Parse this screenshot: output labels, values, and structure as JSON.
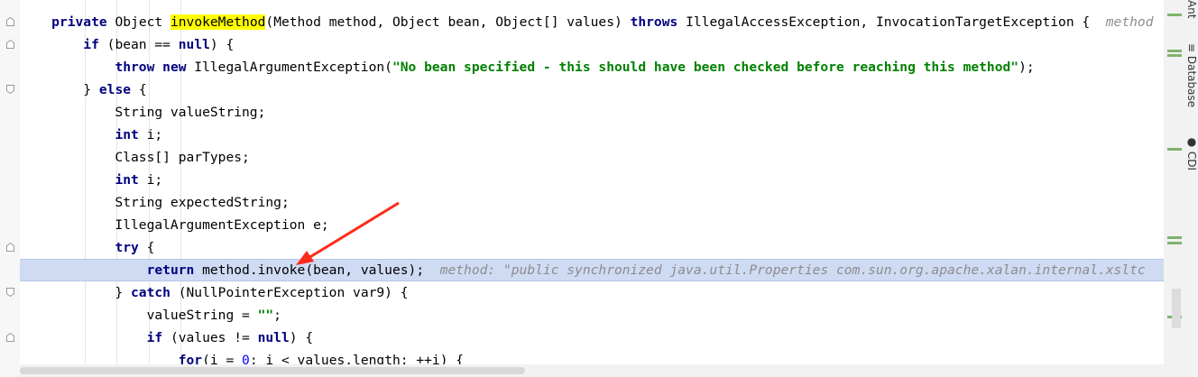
{
  "editor": {
    "lines": [
      {
        "tokens": [
          {
            "t": "    ",
            "c": ""
          },
          {
            "t": "private",
            "c": "kw"
          },
          {
            "t": " Object ",
            "c": ""
          },
          {
            "t": "invokeMethod",
            "c": "mark"
          },
          {
            "t": "(Method method, Object bean, Object[] values) ",
            "c": ""
          },
          {
            "t": "throws",
            "c": "kw"
          },
          {
            "t": " IllegalAccessException, InvocationTargetException {  ",
            "c": ""
          },
          {
            "t": "method",
            "c": "hint"
          }
        ]
      },
      {
        "tokens": [
          {
            "t": "        ",
            "c": ""
          },
          {
            "t": "if",
            "c": "kw"
          },
          {
            "t": " (bean == ",
            "c": ""
          },
          {
            "t": "null",
            "c": "kw"
          },
          {
            "t": ") {",
            "c": ""
          }
        ]
      },
      {
        "tokens": [
          {
            "t": "            ",
            "c": ""
          },
          {
            "t": "throw new",
            "c": "kw"
          },
          {
            "t": " IllegalArgumentException(",
            "c": ""
          },
          {
            "t": "\"No bean specified - this should have been checked before reaching this method\"",
            "c": "str"
          },
          {
            "t": ");",
            "c": ""
          }
        ]
      },
      {
        "tokens": [
          {
            "t": "        } ",
            "c": ""
          },
          {
            "t": "else",
            "c": "kw"
          },
          {
            "t": " {",
            "c": ""
          }
        ]
      },
      {
        "tokens": [
          {
            "t": "            String valueString;",
            "c": ""
          }
        ]
      },
      {
        "tokens": [
          {
            "t": "            ",
            "c": ""
          },
          {
            "t": "int",
            "c": "kw"
          },
          {
            "t": " i;",
            "c": ""
          }
        ]
      },
      {
        "tokens": [
          {
            "t": "            Class[] parTypes;",
            "c": ""
          }
        ]
      },
      {
        "tokens": [
          {
            "t": "            ",
            "c": ""
          },
          {
            "t": "int",
            "c": "kw"
          },
          {
            "t": " i;",
            "c": ""
          }
        ]
      },
      {
        "tokens": [
          {
            "t": "            String expectedString;",
            "c": ""
          }
        ]
      },
      {
        "tokens": [
          {
            "t": "            IllegalArgumentException e;",
            "c": ""
          }
        ]
      },
      {
        "tokens": [
          {
            "t": "            ",
            "c": ""
          },
          {
            "t": "try",
            "c": "kw"
          },
          {
            "t": " {",
            "c": ""
          }
        ]
      },
      {
        "highlight": true,
        "tokens": [
          {
            "t": "                ",
            "c": ""
          },
          {
            "t": "return",
            "c": "kw"
          },
          {
            "t": " method.invoke(bean, values);  ",
            "c": ""
          },
          {
            "t": "method: \"public synchronized java.util.Properties com.sun.org.apache.xalan.internal.xsltc",
            "c": "hint"
          }
        ]
      },
      {
        "tokens": [
          {
            "t": "            } ",
            "c": ""
          },
          {
            "t": "catch",
            "c": "kw"
          },
          {
            "t": " (NullPointerException var9) {",
            "c": ""
          }
        ]
      },
      {
        "tokens": [
          {
            "t": "                valueString = ",
            "c": ""
          },
          {
            "t": "\"\"",
            "c": "str"
          },
          {
            "t": ";",
            "c": ""
          }
        ]
      },
      {
        "tokens": [
          {
            "t": "                ",
            "c": ""
          },
          {
            "t": "if",
            "c": "kw"
          },
          {
            "t": " (values != ",
            "c": ""
          },
          {
            "t": "null",
            "c": "kw"
          },
          {
            "t": ") {",
            "c": ""
          }
        ]
      },
      {
        "tokens": [
          {
            "t": "                    ",
            "c": ""
          },
          {
            "t": "for",
            "c": "kw"
          },
          {
            "t": "(i = ",
            "c": ""
          },
          {
            "t": "0",
            "c": "num"
          },
          {
            "t": "; i < values.length; ++i) {",
            "c": ""
          }
        ]
      }
    ]
  },
  "side_tabs": {
    "ant": "Ant",
    "database": "Database",
    "cdi": "CDI"
  },
  "colors": {
    "keyword": "#000080",
    "string": "#008000",
    "hint": "#8c8c8c",
    "highlight_line": "#cfdbf3",
    "search_match": "#ffff00",
    "arrow": "#ff2a1a"
  }
}
